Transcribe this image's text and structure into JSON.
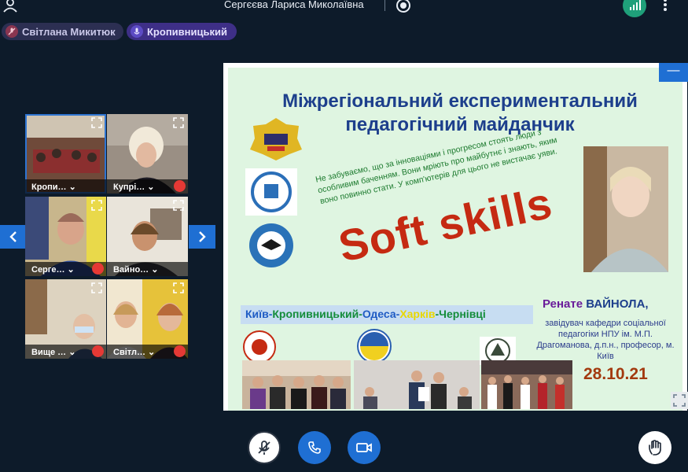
{
  "header": {
    "host_name": "Сергєєва Лариса Миколаївна"
  },
  "speakers": [
    {
      "name": "Світлана Микитюк",
      "icon": "muted-mic-icon"
    },
    {
      "name": "Кропивницький",
      "icon": "mic-icon"
    }
  ],
  "participants": [
    {
      "label": "Кропи… ⌄",
      "active": true
    },
    {
      "label": "Купрі… ⌄",
      "muted": true
    },
    {
      "label": "Серге… ⌄",
      "muted": true
    },
    {
      "label": "Вайно… ⌄"
    },
    {
      "label": "Вище … ⌄",
      "muted": true
    },
    {
      "label": "Світл… ⌄",
      "muted": true
    }
  ],
  "slide": {
    "title_line1": "Міжрегіональний експериментальний",
    "title_line2": "педагогічний майданчик",
    "quote": "Не забуваємо, що за інноваціями і прогресом стоять люди з особливим баченням. Вони мріють про майбутнє і знають, яким воно повинно стати. У комп'ютерів для цього не вистачає уяви.",
    "headline": "Soft skills",
    "cities": {
      "kyiv": "Київ",
      "dash1": "-",
      "kropyvnytskyi": "Кропивницький",
      "dash2": "-",
      "odesa": "Одеса",
      "dash3": "-",
      "kharkiv": "Харків",
      "dash4": "-",
      "chernivtsi": "Чернівці"
    },
    "speaker_first": "Ренате ",
    "speaker_last": "ВАЙНОЛА",
    "speaker_comma": ",",
    "speaker_role": "завідувач кафедри соціальної педагогіки НПУ ім. М.П. Драгоманова, д.п.н., професор, м. Київ",
    "date": "28.10.21"
  },
  "controls": {
    "minimize_label": "—"
  },
  "colors": {
    "background": "#0d1b2a",
    "accent": "#1f6fd3",
    "signal": "#1fa07a",
    "muted": "#e53935"
  }
}
